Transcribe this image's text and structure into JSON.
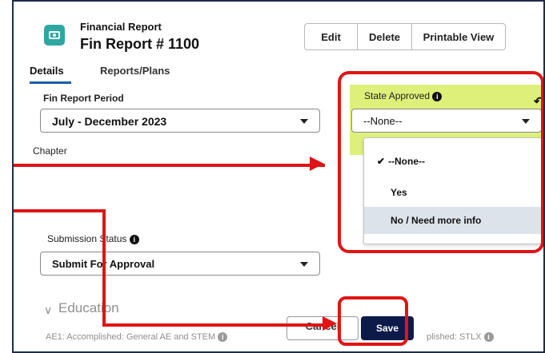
{
  "header": {
    "object_label": "Financial Report",
    "record_title": "Fin Report # 1100",
    "buttons": {
      "edit": "Edit",
      "delete": "Delete",
      "printable_view": "Printable View"
    }
  },
  "tabs": [
    {
      "label": "Details",
      "active": true
    },
    {
      "label": "Reports/Plans",
      "active": false
    }
  ],
  "fields": {
    "fin_report_period": {
      "label": "Fin Report Period",
      "value": "July - December 2023"
    },
    "chapter": {
      "label": "Chapter"
    },
    "submission_status": {
      "label": "Submission Status",
      "value": "Submit For Approval"
    },
    "state_approved": {
      "label": "State Approved",
      "value": "--None--",
      "options": [
        "--None--",
        "Yes",
        "No / Need more info"
      ],
      "selected_option": "--None--",
      "highlighted_option": "No / Need more info",
      "panel_color": "#dff07a"
    }
  },
  "section": {
    "title": "Education"
  },
  "footer": {
    "left_text": "AE1: Accomplished: General AE and STEM",
    "right_text": "plished: STLX",
    "cancel_label": "Cancel",
    "save_label": "Save"
  },
  "icons": {
    "app": "financial-report-icon",
    "info": "info-icon",
    "undo": "undo-icon",
    "caret": "chevron-down-icon",
    "check": "check-icon"
  },
  "colors": {
    "annotation": "#e01414",
    "tab_underline": "#1b5fa6",
    "save_button": "#0c1a4a",
    "app_icon": "#2ea7a2"
  }
}
